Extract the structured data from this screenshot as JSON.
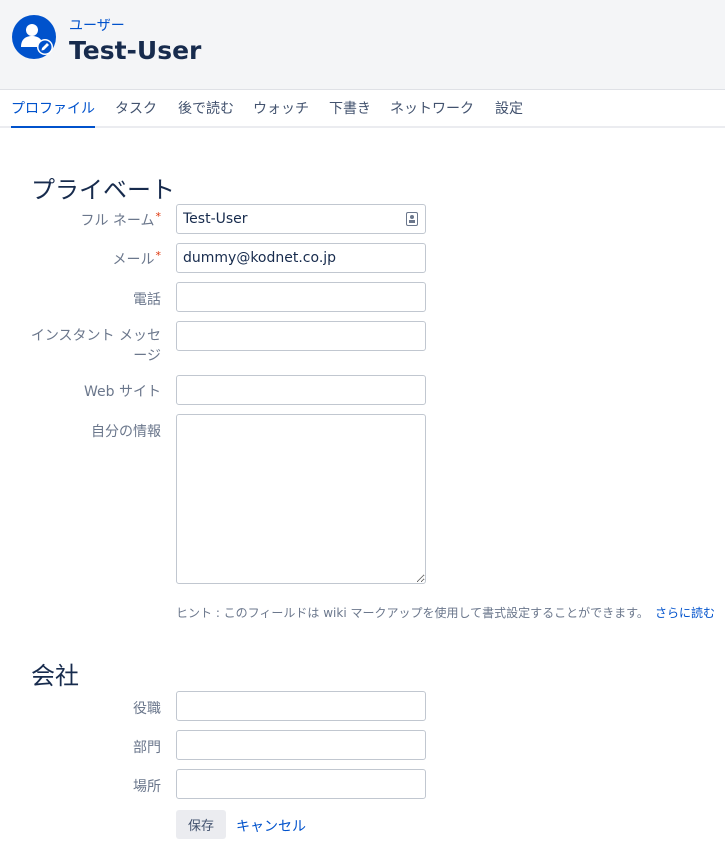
{
  "header": {
    "breadcrumb": "ユーザー",
    "title": "Test-User"
  },
  "tabs": [
    {
      "label": "プロファイル",
      "active": true
    },
    {
      "label": "タスク"
    },
    {
      "label": "後で読む"
    },
    {
      "label": "ウォッチ"
    },
    {
      "label": "下書き"
    },
    {
      "label": "ネットワーク"
    },
    {
      "label": "設定"
    }
  ],
  "private": {
    "title": "プライベート",
    "fullname": {
      "label": "フル ネーム",
      "value": "Test-User",
      "required_mark": "*"
    },
    "email": {
      "label": "メール",
      "value": "dummy@kodnet.co.jp",
      "required_mark": "*"
    },
    "phone": {
      "label": "電話",
      "value": ""
    },
    "im": {
      "label": "インスタント メッセージ",
      "value": ""
    },
    "website": {
      "label": "Web サイト",
      "value": ""
    },
    "about": {
      "label": "自分の情報",
      "value": ""
    },
    "hint": "ヒント : このフィールドは wiki マークアップを使用して書式設定することができます。",
    "hint_link": "さらに読む"
  },
  "company": {
    "title": "会社",
    "position": {
      "label": "役職",
      "value": ""
    },
    "department": {
      "label": "部門",
      "value": ""
    },
    "location": {
      "label": "場所",
      "value": ""
    }
  },
  "actions": {
    "save": "保存",
    "cancel": "キャンセル"
  },
  "colors": {
    "accent": "#0052cc",
    "header_bg": "#f4f5f7",
    "required": "#de350b"
  }
}
